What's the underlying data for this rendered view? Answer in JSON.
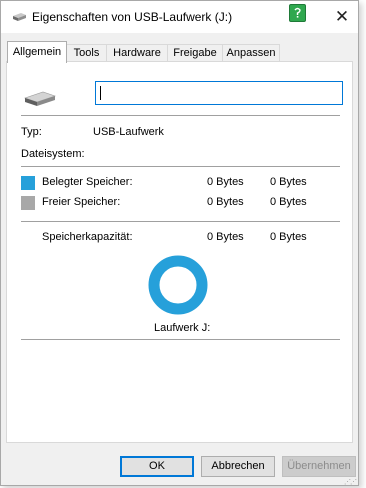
{
  "window": {
    "title": "Eigenschaften von USB-Laufwerk (J:)",
    "close_glyph": "✕",
    "icons": {
      "title": "drive-icon",
      "help": "help-icon",
      "close": "close-icon"
    }
  },
  "tabs": [
    "Allgemein",
    "Tools",
    "Hardware",
    "Freigabe",
    "Anpassen"
  ],
  "active_tab": "Allgemein",
  "general": {
    "name_value": "",
    "type_label": "Typ:",
    "type_value": "USB-Laufwerk",
    "filesystem_label": "Dateisystem:",
    "filesystem_value": "",
    "used_label": "Belegter Speicher:",
    "used_bytes": "0 Bytes",
    "used_size": "0 Bytes",
    "free_label": "Freier Speicher:",
    "free_bytes": "0 Bytes",
    "free_size": "0 Bytes",
    "capacity_label": "Speicherkapazität:",
    "capacity_bytes": "0 Bytes",
    "capacity_size": "0 Bytes",
    "drive_label": "Laufwerk J:"
  },
  "colors": {
    "used": "#26a0da",
    "free": "#a8a8a8",
    "accent": "#0078d7"
  },
  "buttons": {
    "ok": "OK",
    "cancel": "Abbrechen",
    "apply": "Übernehmen"
  }
}
